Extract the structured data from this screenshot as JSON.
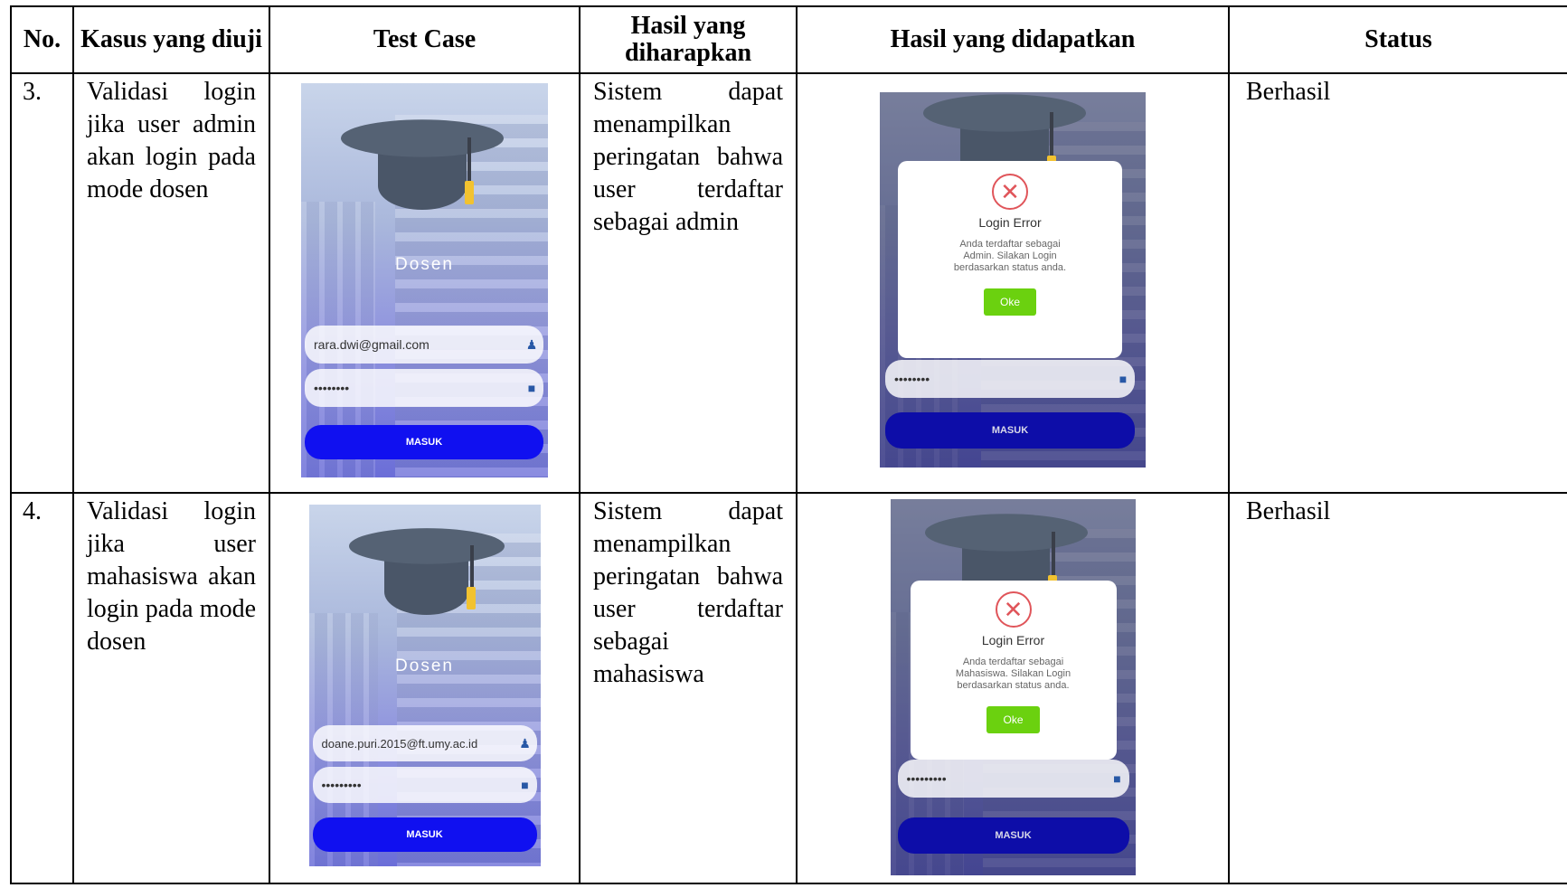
{
  "headers": {
    "no": "No.",
    "kasus": "Kasus yang diuji",
    "test_case": "Test Case",
    "harapan": "Hasil yang diharapkan",
    "didapatkan": "Hasil yang didapatkan",
    "status": "Status"
  },
  "rows": [
    {
      "no": "3.",
      "kasus": "Validasi login jika user admin akan login pada mode dosen",
      "harapan": "Sistem dapat menampilkan peringatan bahwa user terdaftar sebagai admin",
      "status": "Berhasil",
      "test_case_screen": {
        "title": "Dosen",
        "email": "rara.dwi@gmail.com",
        "password": "••••••••",
        "button": "MASUK"
      },
      "result_screen": {
        "dialog_title": "Login Error",
        "dialog_message": "Anda terdaftar sebagai Admin. Silakan Login berdasarkan status anda.",
        "ok_button": "Oke",
        "password": "••••••••",
        "button": "MASUK"
      }
    },
    {
      "no": "4.",
      "kasus": "Validasi login jika user mahasiswa akan login pada mode dosen",
      "harapan": "Sistem dapat menampilkan peringatan bahwa user terdaftar sebagai mahasiswa",
      "status": "Berhasil",
      "test_case_screen": {
        "title": "Dosen",
        "email": "doane.puri.2015@ft.umy.ac.id",
        "password": "•••••••••",
        "button": "MASUK"
      },
      "result_screen": {
        "dialog_title": "Login Error",
        "dialog_message": "Anda terdaftar sebagai Mahasiswa. Silakan Login berdasarkan status anda.",
        "ok_button": "Oke",
        "password": "•••••••••",
        "button": "MASUK"
      }
    }
  ],
  "icons": {
    "user": "user-icon",
    "lock": "lock-icon",
    "error": "error-circle-icon",
    "cap": "graduation-cap-icon"
  }
}
